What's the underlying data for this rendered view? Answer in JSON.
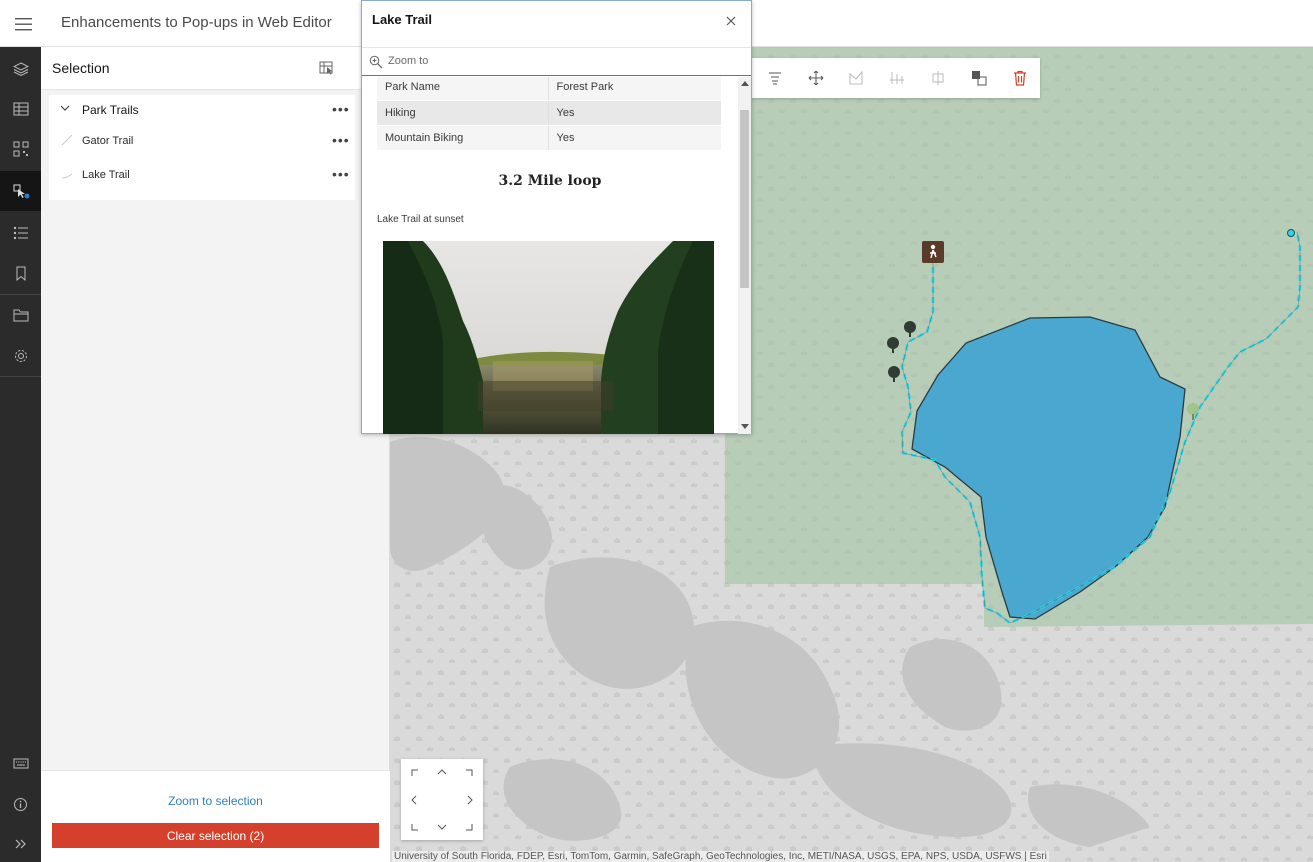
{
  "header": {
    "title": "Enhancements to Pop-ups in Web Editor"
  },
  "iconbar": {
    "items": [
      {
        "icon": "layers-icon"
      },
      {
        "icon": "table-icon"
      },
      {
        "icon": "qr-grid-icon"
      },
      {
        "icon": "selection-icon",
        "active": true
      },
      {
        "icon": "legend-list-icon"
      },
      {
        "icon": "bookmark-icon"
      },
      {
        "icon": "folder-icon"
      },
      {
        "icon": "gear-icon"
      },
      {
        "icon": "keyboard-icon"
      },
      {
        "icon": "info-icon"
      },
      {
        "icon": "expand-icon"
      }
    ]
  },
  "selection_panel": {
    "title": "Selection",
    "group": {
      "label": "Park Trails",
      "items": [
        {
          "label": "Gator Trail"
        },
        {
          "label": "Lake Trail"
        }
      ]
    },
    "zoom_to_selection": "Zoom to selection",
    "clear_selection": "Clear selection (2)"
  },
  "popup": {
    "title": "Lake Trail",
    "zoom_to": "Zoom to",
    "attributes": [
      {
        "key": "Park Name",
        "value": "Forest Park"
      },
      {
        "key": "Hiking",
        "value": "Yes"
      },
      {
        "key": "Mountain Biking",
        "value": "Yes"
      }
    ],
    "heading": "3.2 Mile loop",
    "caption": "Lake Trail at sunset"
  },
  "map": {
    "attribution": "University of South Florida, FDEP, Esri, TomTom, Garmin, SafeGraph, GeoTechnologies, Inc, METI/NASA, USGS, EPA, NPS, USDA, USFWS | Esri",
    "colors": {
      "park_green": "#b7cdb7",
      "lake_fill": "#4aa8d0",
      "trail_cyan": "#2fd3e6",
      "base_gray": "#d9dad9",
      "water_gray": "#c4c5c4"
    }
  },
  "colors": {
    "accent_blue": "#2e7ec2",
    "danger_red": "#d4402b",
    "iconbar_bg": "#2b2b2b"
  }
}
